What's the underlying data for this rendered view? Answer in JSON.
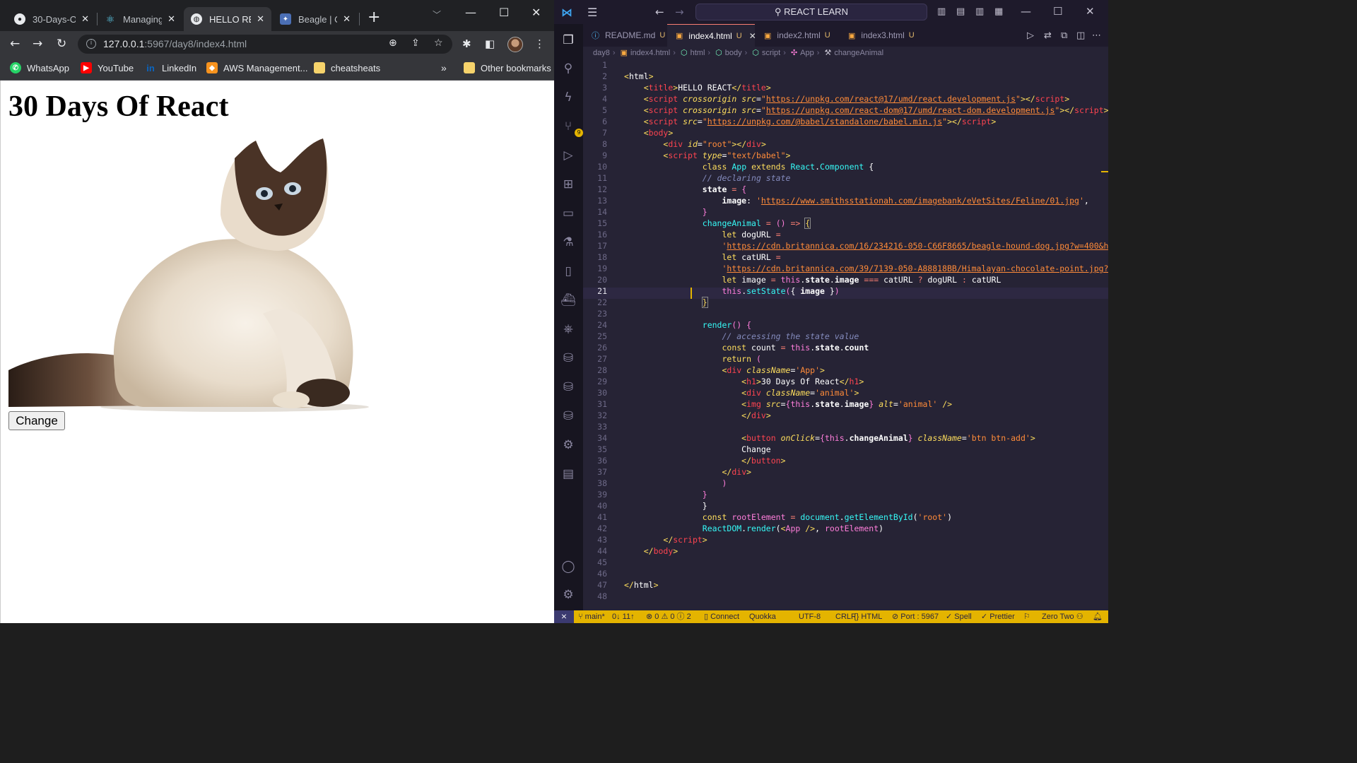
{
  "browser": {
    "tabs": [
      {
        "title": "30-Days-O",
        "favicon": "github-icon"
      },
      {
        "title": "Managing",
        "favicon": "react-icon"
      },
      {
        "title": "HELLO REA",
        "favicon": "globe-icon",
        "active": true
      },
      {
        "title": "Beagle | O",
        "favicon": "britannica-icon"
      }
    ],
    "url_host": "127.0.0.1",
    "url_rest": ":5967/day8/index4.html",
    "bookmarks": [
      {
        "label": "WhatsApp",
        "icon": "whatsapp-icon",
        "color": "#25d366"
      },
      {
        "label": "YouTube",
        "icon": "youtube-icon",
        "color": "#ff0000"
      },
      {
        "label": "LinkedIn",
        "icon": "linkedin-icon",
        "color": "#0a66c2"
      },
      {
        "label": "AWS Management...",
        "icon": "aws-icon",
        "color": "#f7931e"
      },
      {
        "label": "cheatsheats",
        "icon": "folder-icon",
        "color": "#f6d36b"
      }
    ],
    "bookmarks_more": "»",
    "other_bookmarks": "Other bookmarks",
    "page": {
      "heading": "30 Days Of React",
      "image_alt": "animal",
      "button_label": "Change"
    }
  },
  "vscode": {
    "search": "REACT LEARN",
    "tabs": [
      {
        "label": "README.md",
        "status": "U",
        "icon": "info-icon"
      },
      {
        "label": "index4.html",
        "status": "U",
        "icon": "html-icon",
        "active": true
      },
      {
        "label": "index2.html",
        "status": "U",
        "icon": "html-icon"
      },
      {
        "label": "index3.html",
        "status": "U",
        "icon": "html-icon"
      }
    ],
    "breadcrumbs": [
      "day8",
      "index4.html",
      "html",
      "body",
      "script",
      "App",
      "changeAnimal"
    ],
    "current_line": 21,
    "status_bar": {
      "branch": "main*",
      "sync": "0↓ 11↑",
      "problems": "⊗ 0 ⚠ 0 ⓘ 2",
      "connect": "Connect",
      "quokka": "Quokka",
      "encoding": "UTF-8",
      "eol": "CRLF",
      "language": "HTML",
      "port": "Port : 5967",
      "spell": "Spell",
      "prettier": "Prettier",
      "zero_two": "Zero Two"
    }
  }
}
